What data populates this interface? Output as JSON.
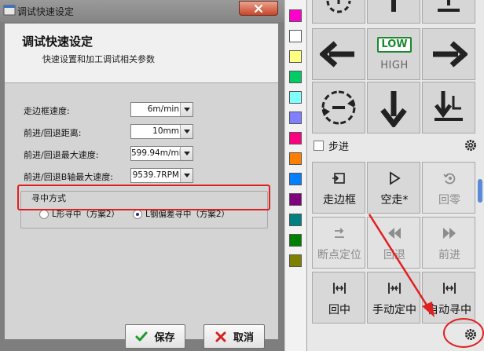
{
  "window": {
    "title": "调试快速设定",
    "app_icon": "app-window-icon",
    "close_icon": "close-icon"
  },
  "header": {
    "title": "调试快速设定",
    "subtitle": "快速设置和加工调试相关参数"
  },
  "fields": [
    {
      "label": "走边框速度:",
      "value": "6m/min"
    },
    {
      "label": "前进/回退距离:",
      "value": "10mm"
    },
    {
      "label": "前进/回退最大速度:",
      "value": "599.94m/mi"
    },
    {
      "label": "前进/回退B轴最大速度:",
      "value": "9539.7RPM"
    }
  ],
  "center_mode": {
    "title": "寻中方式",
    "options": [
      {
        "label": "L形寻中（方案2）",
        "checked": false
      },
      {
        "label": "L钢偏差寻中（方案2）",
        "checked": true
      }
    ]
  },
  "buttons": {
    "save": "保存",
    "cancel": "取消"
  },
  "palette": [
    "#ff00cc",
    "#ffffff",
    "#ffff80",
    "#00cc66",
    "#80ffff",
    "#8080ff",
    "#ff0080",
    "#ff8000",
    "#0080ff",
    "#800080",
    "#008080",
    "#008000",
    "#808000"
  ],
  "jog": {
    "low": "LOW",
    "high": "HIGH",
    "colors": {
      "low_border": "#1a8a2e",
      "high_text": "#666666"
    },
    "icons": [
      "rotate-cw-icon",
      "arrow-up-icon",
      "to-base-icon",
      "arrow-left-icon",
      "arrow-right-icon",
      "rotate-ccw-icon",
      "arrow-down-icon",
      "move-down-icon"
    ]
  },
  "step": {
    "label": "步进",
    "checked": false
  },
  "functions": [
    {
      "label": "走边框",
      "icon": "frame-icon",
      "enabled": true
    },
    {
      "label": "空走*",
      "icon": "play-icon",
      "enabled": true
    },
    {
      "label": "回零",
      "icon": "home-icon",
      "enabled": false
    },
    {
      "label": "断点定位",
      "icon": "breakpoint-icon",
      "enabled": false
    },
    {
      "label": "回退",
      "icon": "rewind-icon",
      "enabled": false
    },
    {
      "label": "前进",
      "icon": "forward-icon",
      "enabled": false
    },
    {
      "label": "回中",
      "icon": "center-icon",
      "enabled": true
    },
    {
      "label": "手动定中",
      "icon": "manual-center-icon",
      "enabled": true
    },
    {
      "label": "自动寻中",
      "icon": "auto-center-icon",
      "enabled": true
    }
  ],
  "annotation_color": "#e02020"
}
